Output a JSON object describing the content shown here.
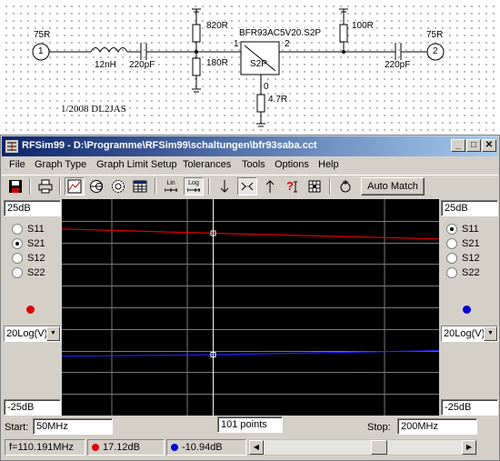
{
  "schematic": {
    "port1_label": "75R",
    "port1_number": "1",
    "port2_label": "75R",
    "port2_number": "2",
    "inductor_label": "12nH",
    "cap1_label": "220pF",
    "cap2_label": "220pF",
    "r_top1_label": "820R",
    "r_bottom1_label": "180R",
    "r_top2_label": "100R",
    "r_emitter_label": "4.7R",
    "device_label": "BFR93AC5V20.S2P",
    "device_box_label": "S2P",
    "pin1": "1",
    "pin2": "2",
    "pin0": "0",
    "note": "1/2008 DL2JAS"
  },
  "window": {
    "title": "RFSim99 - D:\\Programme\\RFSim99\\schaltungen\\bfr93saba.cct",
    "minimize": "_",
    "maximize": "□",
    "close": "✕"
  },
  "menu": [
    "File",
    "Graph Type",
    "Graph Limit Setup",
    "Tolerances",
    "Tools",
    "Options",
    "Help"
  ],
  "toolbar": {
    "icons": [
      "save-icon",
      "print-icon",
      "rect-graph-icon",
      "smith-chart-icon",
      "polar-chart-icon",
      "table-icon",
      "lin-scale-icon",
      "log-scale-icon",
      "arrow-down-icon",
      "zoom-in-icon",
      "arrow-up-icon",
      "help-icon",
      "puzzle-icon",
      "cursor-icon"
    ],
    "lin_label": "Lin",
    "log_label": "Log",
    "auto_match_label": "Auto Match"
  },
  "left_panel": {
    "top_value": "25dB",
    "bottom_value": "-25dB",
    "params": [
      "S11",
      "S21",
      "S12",
      "S22"
    ],
    "selected": "S21",
    "marker_color": "#e00000",
    "scale": "20Log(V)"
  },
  "right_panel": {
    "top_value": "25dB",
    "bottom_value": "-25dB",
    "params": [
      "S11",
      "S21",
      "S12",
      "S22"
    ],
    "selected": "S11",
    "marker_color": "#0000e0",
    "scale": "20Log(V)"
  },
  "sweep": {
    "start_label": "Start:",
    "start_value": "50MHz",
    "points": "101 points",
    "stop_label": "Stop:",
    "stop_value": "200MHz"
  },
  "status": {
    "freq": "f=110.191MHz",
    "red_value": "17.12dB",
    "blue_value": "-10.94dB"
  },
  "chart_data": {
    "type": "line",
    "ylim": [
      -25,
      25
    ],
    "xlim": [
      50,
      200
    ],
    "x": [
      50,
      110.191,
      200
    ],
    "series": [
      {
        "color": "#e00000",
        "values": [
          18.1,
          17.12,
          15.8
        ]
      },
      {
        "color": "#2020ff",
        "values": [
          -11.3,
          -10.94,
          -10.0
        ]
      }
    ],
    "cursor_x": 110.191,
    "grid": true
  },
  "colors": {
    "titlebar_start": "#0a246a",
    "titlebar_end": "#a6caf0",
    "window_bg": "#d4d0c8",
    "plot_bg": "#000000",
    "grid": "#7a7a7a"
  }
}
